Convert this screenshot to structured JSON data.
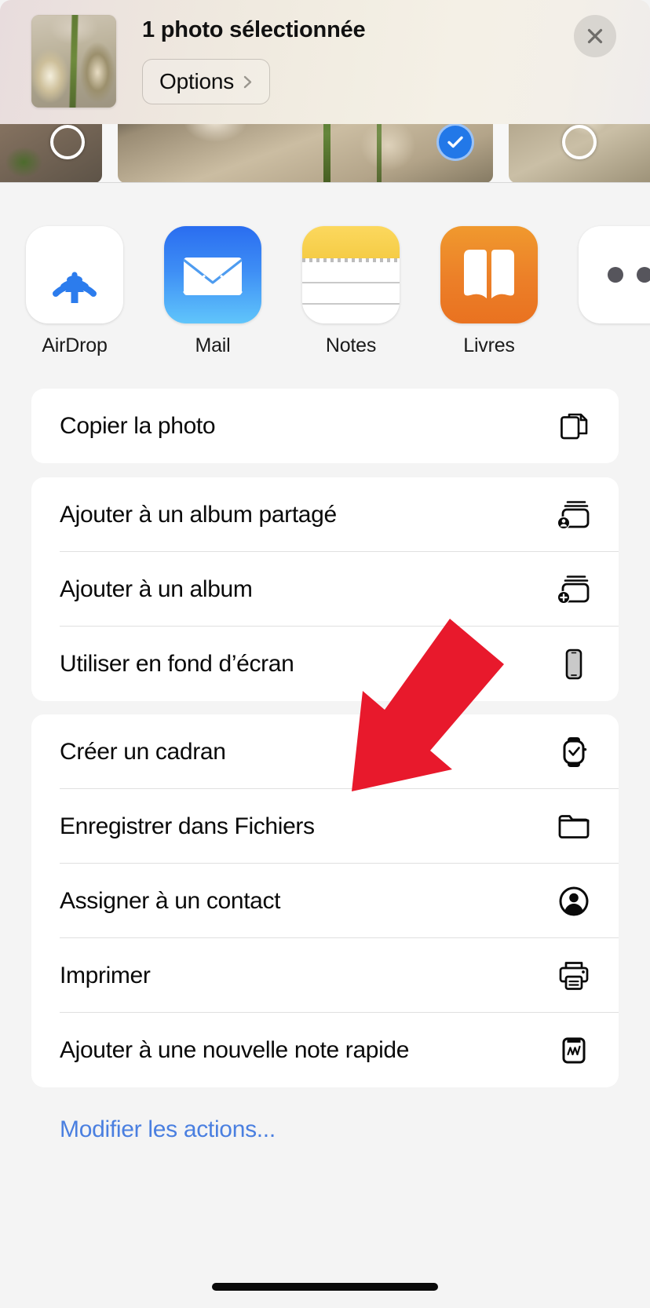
{
  "header": {
    "title": "1 photo sélectionnée",
    "options_label": "Options",
    "options_chevron_icon": "chevron-right-icon",
    "close_icon": "close-icon",
    "thumbnail_icon": "photo-thumbnail"
  },
  "photo_strip": {
    "selected_count": 1,
    "items": [
      {
        "state": "unselected",
        "icon": "selection-ring-icon"
      },
      {
        "state": "selected",
        "icon": "checkmark-circle-icon"
      },
      {
        "state": "unselected",
        "icon": "selection-ring-icon"
      }
    ]
  },
  "apps": [
    {
      "name": "AirDrop",
      "icon": "airdrop-icon"
    },
    {
      "name": "Mail",
      "icon": "mail-icon"
    },
    {
      "name": "Notes",
      "icon": "notes-icon"
    },
    {
      "name": "Livres",
      "icon": "books-icon"
    },
    {
      "name": "",
      "icon": "more-apps-icon"
    }
  ],
  "sections": [
    {
      "rows": [
        {
          "label": "Copier la photo",
          "icon": "copy-icon"
        }
      ]
    },
    {
      "rows": [
        {
          "label": "Ajouter à un album partagé",
          "icon": "shared-album-icon"
        },
        {
          "label": "Ajouter à un album",
          "icon": "add-to-album-icon"
        },
        {
          "label": "Utiliser en fond d’écran",
          "icon": "wallpaper-iphone-icon"
        }
      ]
    },
    {
      "rows": [
        {
          "label": "Créer un cadran",
          "icon": "watch-face-icon"
        },
        {
          "label": "Enregistrer dans Fichiers",
          "icon": "folder-icon"
        },
        {
          "label": "Assigner à un contact",
          "icon": "contact-icon"
        },
        {
          "label": "Imprimer",
          "icon": "printer-icon"
        },
        {
          "label": "Ajouter à une nouvelle note rapide",
          "icon": "quick-note-icon"
        }
      ]
    }
  ],
  "footer": {
    "edit_actions_label": "Modifier les actions...",
    "edit_actions_color": "#4a7fe0"
  },
  "annotation": {
    "arrow_icon": "red-arrow-icon",
    "arrow_color": "#E8192C",
    "points_at": "Enregistrer dans Fichiers"
  },
  "colors": {
    "background": "#f4f4f4",
    "card": "#ffffff",
    "divider": "#e0e0e0",
    "accent_blue": "#2278e8",
    "text_primary": "#0a0a0a"
  }
}
